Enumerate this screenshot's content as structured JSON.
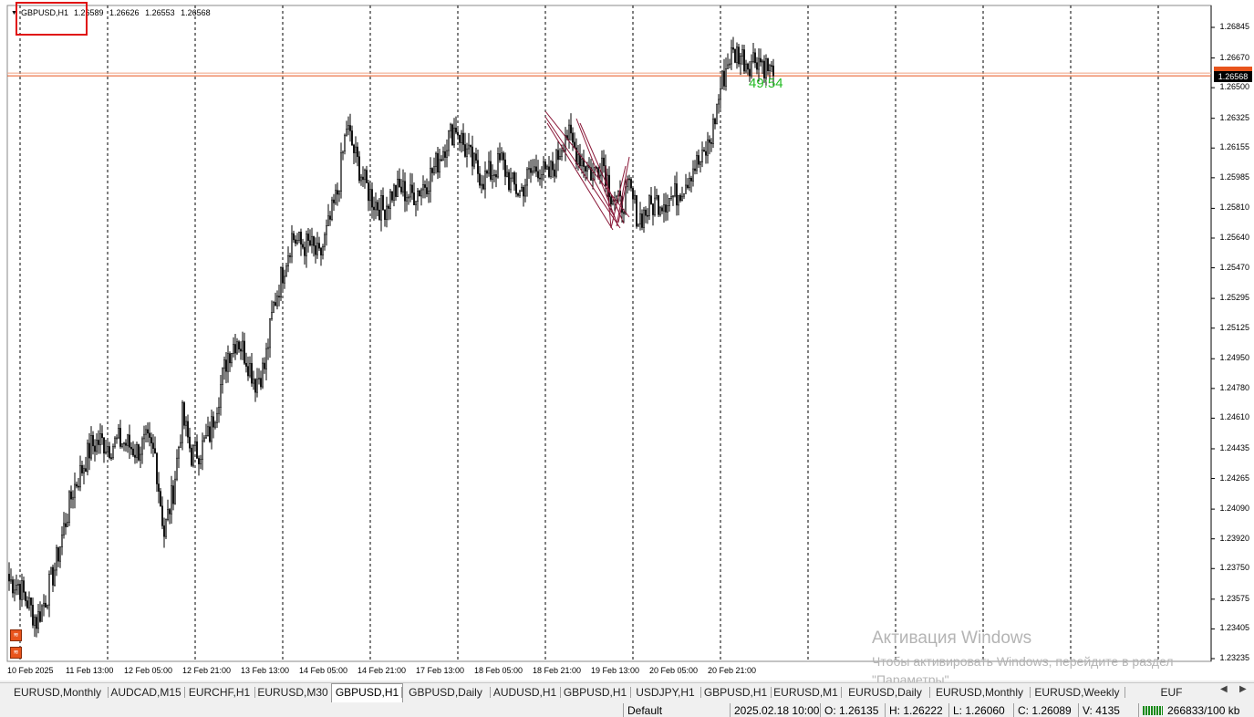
{
  "chart": {
    "symbol": "GBPUSD,H1",
    "ohlc": [
      "1.26589",
      "1.26626",
      "1.26553",
      "1.26568"
    ],
    "current_price": "1.26568",
    "countdown": "49:54",
    "price_levels": [
      "1.26845",
      "1.26670",
      "1.26500",
      "1.26325",
      "1.26155",
      "1.25985",
      "1.25810",
      "1.25640",
      "1.25470",
      "1.25295",
      "1.25125",
      "1.24950",
      "1.24780",
      "1.24610",
      "1.24435",
      "1.24265",
      "1.24090",
      "1.23920",
      "1.23750",
      "1.23575",
      "1.23405",
      "1.23235"
    ],
    "time_labels": [
      "10 Feb 2025",
      "11 Feb 13:00",
      "12 Feb 05:00",
      "12 Feb 21:00",
      "13 Feb 13:00",
      "14 Feb 05:00",
      "14 Feb 21:00",
      "17 Feb 13:00",
      "18 Feb 05:00",
      "18 Feb 21:00",
      "19 Feb 13:00",
      "20 Feb 05:00",
      "20 Feb 21:00"
    ],
    "colors": {
      "bid_line": "#e8541c",
      "countdown": "#22bb22",
      "drawn_lines": "#8b1a3a",
      "candles": "#000000",
      "grid": "#000000"
    }
  },
  "chart_data": {
    "type": "candlestick",
    "symbol": "GBPUSD",
    "timeframe": "H1",
    "ylim": [
      1.23235,
      1.26845
    ],
    "close_path": [
      [
        0,
        1.2368
      ],
      [
        5,
        1.2366
      ],
      [
        10,
        1.2356
      ],
      [
        15,
        1.2345
      ],
      [
        20,
        1.2358
      ],
      [
        25,
        1.2375
      ],
      [
        30,
        1.2398
      ],
      [
        35,
        1.242
      ],
      [
        40,
        1.2432
      ],
      [
        45,
        1.2445
      ],
      [
        50,
        1.2448
      ],
      [
        55,
        1.2445
      ],
      [
        60,
        1.2448
      ],
      [
        65,
        1.2446
      ],
      [
        70,
        1.2442
      ],
      [
        75,
        1.2447
      ],
      [
        80,
        1.244
      ],
      [
        85,
        1.2395
      ],
      [
        90,
        1.242
      ],
      [
        95,
        1.2462
      ],
      [
        100,
        1.244
      ],
      [
        105,
        1.2443
      ],
      [
        110,
        1.2452
      ],
      [
        115,
        1.2475
      ],
      [
        120,
        1.2498
      ],
      [
        125,
        1.2507
      ],
      [
        130,
        1.2496
      ],
      [
        135,
        1.2482
      ],
      [
        140,
        1.249
      ],
      [
        145,
        1.2525
      ],
      [
        150,
        1.2545
      ],
      [
        155,
        1.2565
      ],
      [
        160,
        1.256
      ],
      [
        165,
        1.256
      ],
      [
        170,
        1.2552
      ],
      [
        175,
        1.257
      ],
      [
        180,
        1.259
      ],
      [
        185,
        1.2628
      ],
      [
        190,
        1.261
      ],
      [
        195,
        1.2595
      ],
      [
        200,
        1.2585
      ],
      [
        205,
        1.258
      ],
      [
        210,
        1.259
      ],
      [
        215,
        1.2592
      ],
      [
        220,
        1.2588
      ],
      [
        225,
        1.2592
      ],
      [
        230,
        1.2598
      ],
      [
        235,
        1.2608
      ],
      [
        240,
        1.262
      ],
      [
        245,
        1.2628
      ],
      [
        250,
        1.2615
      ],
      [
        255,
        1.2605
      ],
      [
        260,
        1.2598
      ],
      [
        265,
        1.2602
      ],
      [
        270,
        1.2608
      ],
      [
        275,
        1.2595
      ],
      [
        280,
        1.259
      ],
      [
        285,
        1.26
      ],
      [
        290,
        1.2605
      ],
      [
        295,
        1.2598
      ],
      [
        300,
        1.2608
      ],
      [
        305,
        1.2625
      ],
      [
        310,
        1.2615
      ],
      [
        315,
        1.2608
      ],
      [
        320,
        1.26
      ],
      [
        325,
        1.261
      ],
      [
        330,
        1.259
      ],
      [
        335,
        1.2582
      ],
      [
        340,
        1.2592
      ],
      [
        345,
        1.2575
      ],
      [
        350,
        1.258
      ],
      [
        355,
        1.2585
      ],
      [
        360,
        1.2586
      ],
      [
        365,
        1.2588
      ],
      [
        370,
        1.2595
      ],
      [
        375,
        1.2605
      ],
      [
        380,
        1.2608
      ],
      [
        385,
        1.2622
      ],
      [
        390,
        1.265
      ],
      [
        395,
        1.2668
      ],
      [
        400,
        1.267
      ],
      [
        405,
        1.2664
      ],
      [
        410,
        1.2668
      ],
      [
        415,
        1.2662
      ],
      [
        419,
        1.2657
      ]
    ]
  },
  "tabs": [
    "EURUSD,Monthly",
    "AUDCAD,M15",
    "EURCHF,H1",
    "EURUSD,M30",
    "GBPUSD,H1",
    "GBPUSD,Daily",
    "AUDUSD,H1",
    "GBPUSD,H1",
    "USDJPY,H1",
    "GBPUSD,H1",
    "EURUSD,M1",
    "EURUSD,Daily",
    "EURUSD,Monthly",
    "EURUSD,Weekly",
    "EUF"
  ],
  "active_tab": 4,
  "status": {
    "profile": "Default",
    "datetime": "2025.02.18 10:00",
    "open": "O: 1.26135",
    "high": "H: 1.26222",
    "low": "L: 1.26060",
    "close": "C: 1.26089",
    "volume": "V: 4135",
    "traffic": "266833/100 kb"
  },
  "watermark": {
    "title": "Активация Windows",
    "line1": "Чтобы активировать Windows, перейдите в раздел",
    "line2": "\"Параметры\"."
  }
}
